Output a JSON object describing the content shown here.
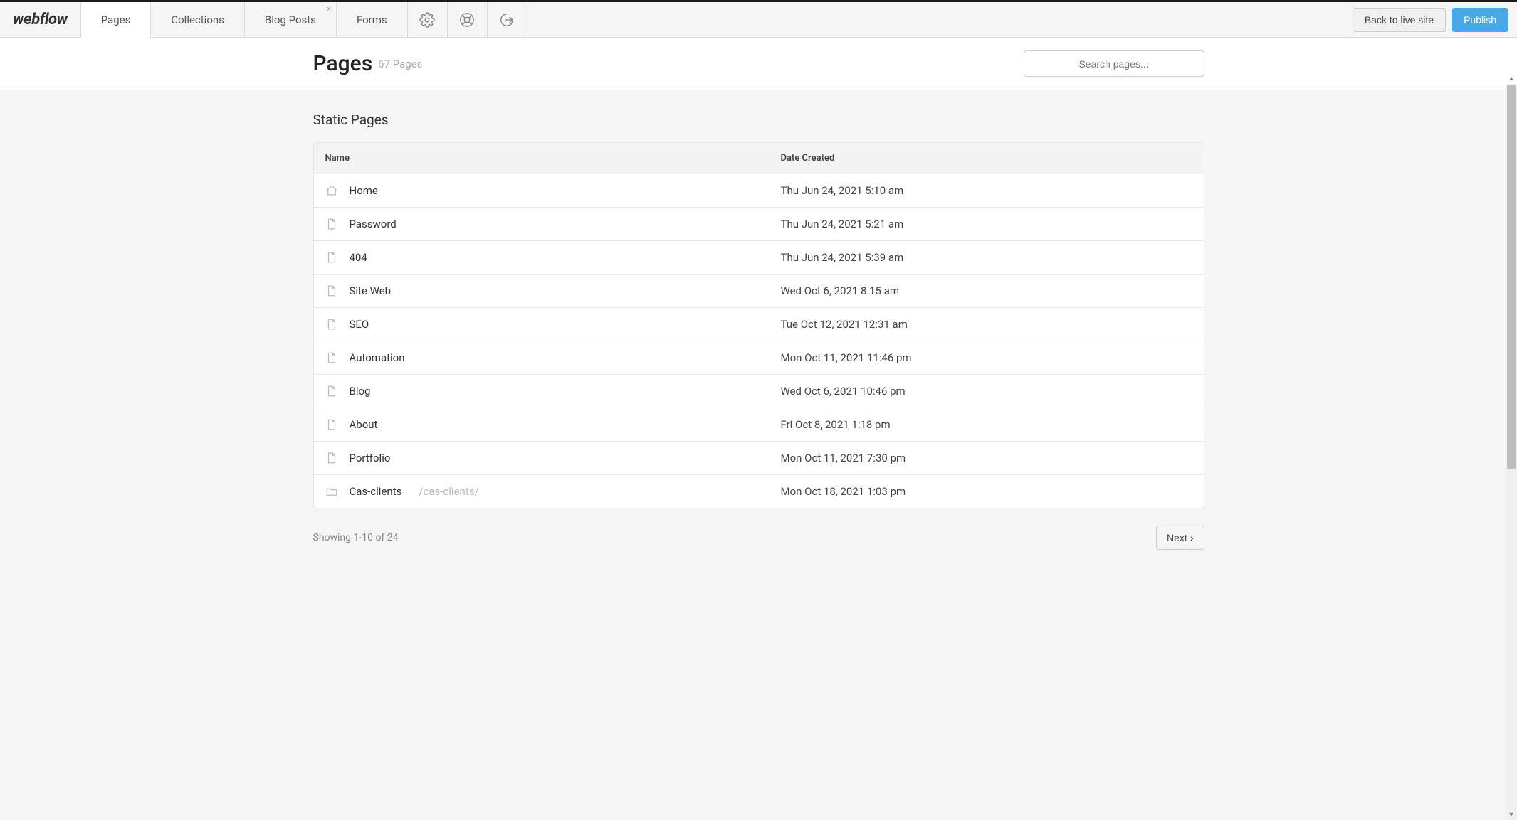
{
  "brand": "webflow",
  "tabs": [
    {
      "label": "Pages",
      "active": true,
      "closable": false
    },
    {
      "label": "Collections",
      "active": false,
      "closable": false
    },
    {
      "label": "Blog Posts",
      "active": false,
      "closable": true
    },
    {
      "label": "Forms",
      "active": false,
      "closable": false
    }
  ],
  "header": {
    "back_label": "Back to live site",
    "publish_label": "Publish"
  },
  "title": {
    "heading": "Pages",
    "count": "67 Pages"
  },
  "search": {
    "placeholder": "Search pages..."
  },
  "section_heading": "Static Pages",
  "columns": {
    "name": "Name",
    "date": "Date Created"
  },
  "rows": [
    {
      "icon": "home",
      "name": "Home",
      "subpath": "",
      "date": "Thu Jun 24, 2021 5:10 am"
    },
    {
      "icon": "page",
      "name": "Password",
      "subpath": "",
      "date": "Thu Jun 24, 2021 5:21 am"
    },
    {
      "icon": "page",
      "name": "404",
      "subpath": "",
      "date": "Thu Jun 24, 2021 5:39 am"
    },
    {
      "icon": "page",
      "name": "Site Web",
      "subpath": "",
      "date": "Wed Oct 6, 2021 8:15 am"
    },
    {
      "icon": "page",
      "name": "SEO",
      "subpath": "",
      "date": "Tue Oct 12, 2021 12:31 am"
    },
    {
      "icon": "page",
      "name": "Automation",
      "subpath": "",
      "date": "Mon Oct 11, 2021 11:46 pm"
    },
    {
      "icon": "page",
      "name": "Blog",
      "subpath": "",
      "date": "Wed Oct 6, 2021 10:46 pm"
    },
    {
      "icon": "page",
      "name": "About",
      "subpath": "",
      "date": "Fri Oct 8, 2021 1:18 pm"
    },
    {
      "icon": "page",
      "name": "Portfolio",
      "subpath": "",
      "date": "Mon Oct 11, 2021 7:30 pm"
    },
    {
      "icon": "folder",
      "name": "Cas-clients",
      "subpath": "/cas-clients/",
      "date": "Mon Oct 18, 2021 1:03 pm"
    }
  ],
  "pagination": {
    "showing": "Showing 1-10 of 24",
    "next_label": "Next"
  }
}
